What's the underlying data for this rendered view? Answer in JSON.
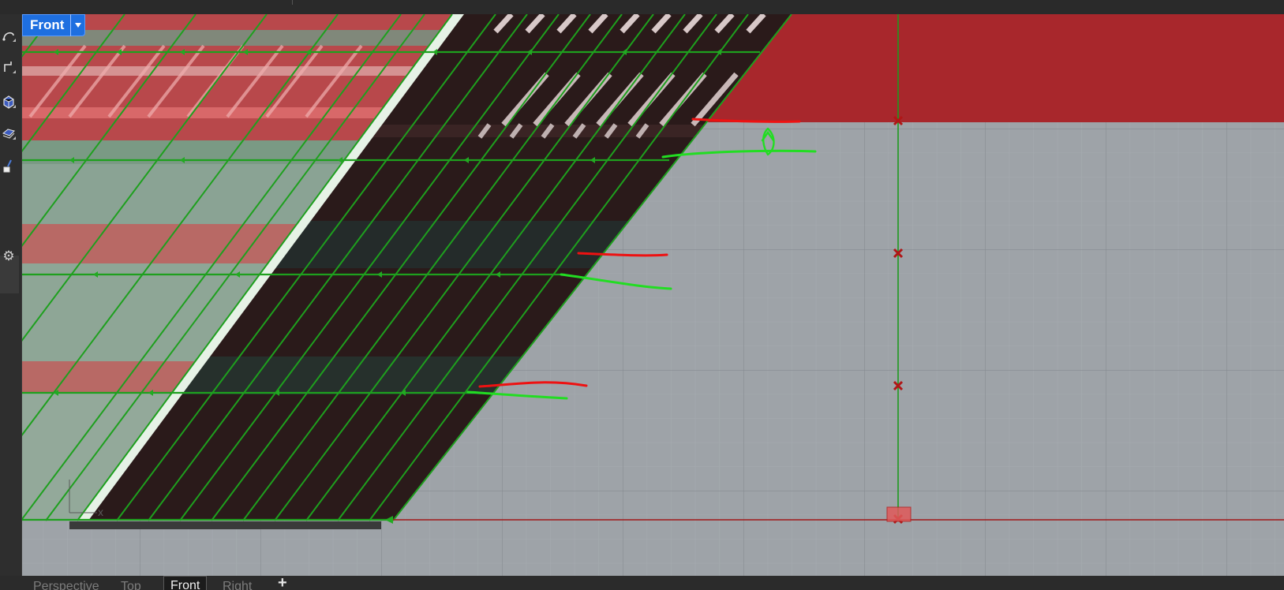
{
  "viewport": {
    "active_view": "Front",
    "dropdown_icon": "caret-down-icon"
  },
  "tabs": [
    {
      "label": "Perspective",
      "active": false
    },
    {
      "label": "Top",
      "active": false
    },
    {
      "label": "Front",
      "active": true
    },
    {
      "label": "Right",
      "active": false
    }
  ],
  "add_tab_label": "+",
  "axis": {
    "x_label": "x"
  },
  "toolbar": {
    "icons": [
      "curve-tool-icon",
      "polyline-tool-icon",
      "solid-tool-icon",
      "surface-tool-icon",
      "transform-tool-icon"
    ],
    "settings_icon": "gear-icon"
  },
  "colors": {
    "viewport_bg": "#9ea3a8",
    "active_label_bg": "#1e6fe0",
    "selection_green": "#1ea01e",
    "annotation_green": "#22dd22",
    "annotation_red": "#ee1111",
    "model_red": "#a8272c",
    "dark_panel": "#2a1a1a"
  }
}
